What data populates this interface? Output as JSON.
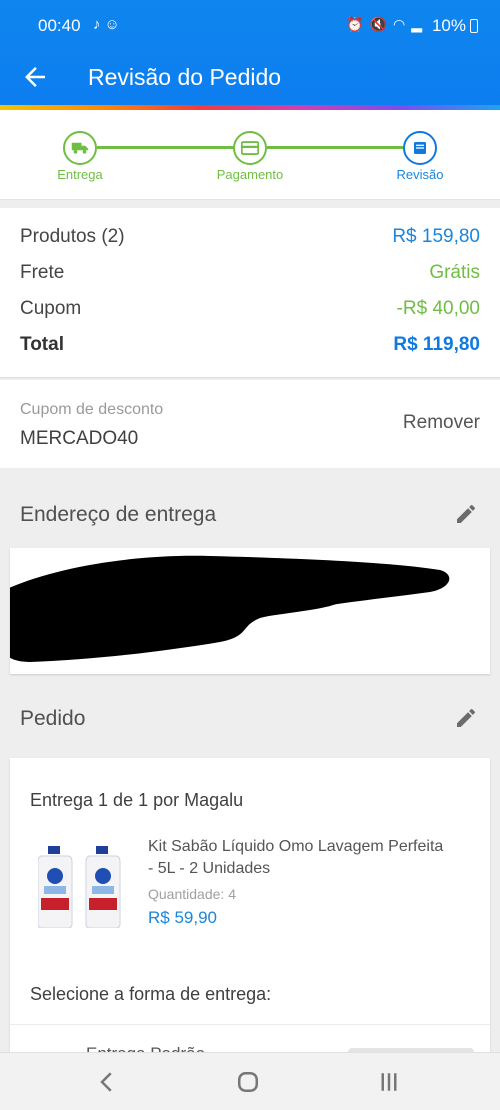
{
  "status_bar": {
    "time": "00:40",
    "left_icons": [
      "music-note-icon",
      "chat-bubble-icon"
    ],
    "right_icons": [
      "alarm-icon",
      "mute-icon",
      "wifi-icon",
      "signal-icon"
    ],
    "battery": "10%"
  },
  "app_bar": {
    "title": "Revisão do Pedido",
    "back_icon": "arrow-left-icon"
  },
  "stepper": {
    "steps": [
      {
        "label": "Entrega",
        "icon": "truck-icon",
        "state": "done"
      },
      {
        "label": "Pagamento",
        "icon": "card-icon",
        "state": "done"
      },
      {
        "label": "Revisão",
        "icon": "document-icon",
        "state": "current"
      }
    ],
    "colors": {
      "done": "#6fbe43",
      "current": "#1079e0"
    }
  },
  "summary": {
    "rows": [
      {
        "label": "Produtos (2)",
        "value": "R$ 159,80"
      },
      {
        "label": "Frete",
        "value": "Grátis"
      },
      {
        "label": "Cupom",
        "value": "-R$ 40,00"
      },
      {
        "label": "Total",
        "value": "R$ 119,80"
      }
    ]
  },
  "coupon": {
    "label": "Cupom de desconto",
    "code": "MERCADO40",
    "remove_label": "Remover"
  },
  "address_section": {
    "title": "Endereço de entrega",
    "edit_icon": "pencil-icon"
  },
  "order_section": {
    "title": "Pedido",
    "edit_icon": "pencil-icon",
    "shipment_title": "Entrega 1 de 1 por Magalu",
    "product": {
      "name": "Kit Sabão Líquido Omo Lavagem Perfeita - 5L - 2 Unidades",
      "quantity_label": "Quantidade:",
      "quantity": "4",
      "price": "R$ 59,90"
    },
    "delivery_prompt": "Selecione a forma de entrega:",
    "option_label": "Entrega Padrão"
  },
  "colors": {
    "primary": "#0e86ee",
    "link_blue": "#1a86dd",
    "green": "#6fbe43"
  }
}
